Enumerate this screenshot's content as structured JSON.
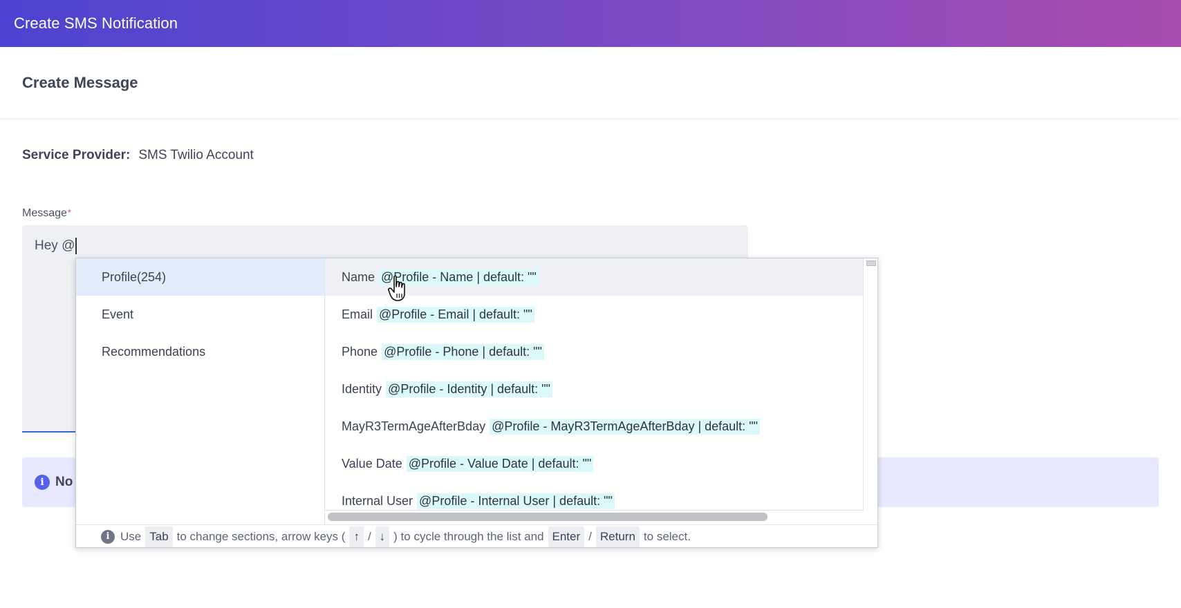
{
  "header": {
    "title": "Create SMS Notification"
  },
  "section": {
    "title": "Create Message"
  },
  "provider": {
    "label": "Service Provider:",
    "value": "SMS Twilio Account"
  },
  "message": {
    "label": "Message",
    "required_mark": "*",
    "value": "Hey @"
  },
  "note": {
    "icon": "info-icon",
    "text_visible": "No"
  },
  "dropdown": {
    "categories": [
      {
        "label": "Profile(254)",
        "active": true
      },
      {
        "label": "Event",
        "active": false
      },
      {
        "label": "Recommendations",
        "active": false
      }
    ],
    "options": [
      {
        "name": "Name",
        "token": "@Profile - Name | default: \"\""
      },
      {
        "name": "Email",
        "token": "@Profile - Email | default: \"\""
      },
      {
        "name": "Phone",
        "token": "@Profile - Phone | default: \"\""
      },
      {
        "name": "Identity",
        "token": "@Profile - Identity | default: \"\""
      },
      {
        "name": "MayR3TermAgeAfterBday",
        "token": "@Profile - MayR3TermAgeAfterBday | default: \"\""
      },
      {
        "name": "Value Date",
        "token": "@Profile - Value Date | default: \"\""
      },
      {
        "name": "Internal User",
        "token": "@Profile - Internal User | default: \"\""
      }
    ],
    "hint": {
      "use": "Use",
      "tab_key": "Tab",
      "change_sections": "to change sections, arrow keys (",
      "up_key": "↑",
      "slash1": "/",
      "down_key": "↓",
      "cycle": ") to cycle through the list and",
      "enter_key": "Enter",
      "slash2": "/",
      "return_key": "Return",
      "select": "to select."
    }
  },
  "colors": {
    "header_gradient_start": "#4b44d0",
    "header_gradient_end": "#a94cae",
    "active_category": "#e3ecfc",
    "token_highlight": "#dcf9f9",
    "note_background": "#e8e9fe",
    "focus_underline": "#2b6cd4"
  }
}
